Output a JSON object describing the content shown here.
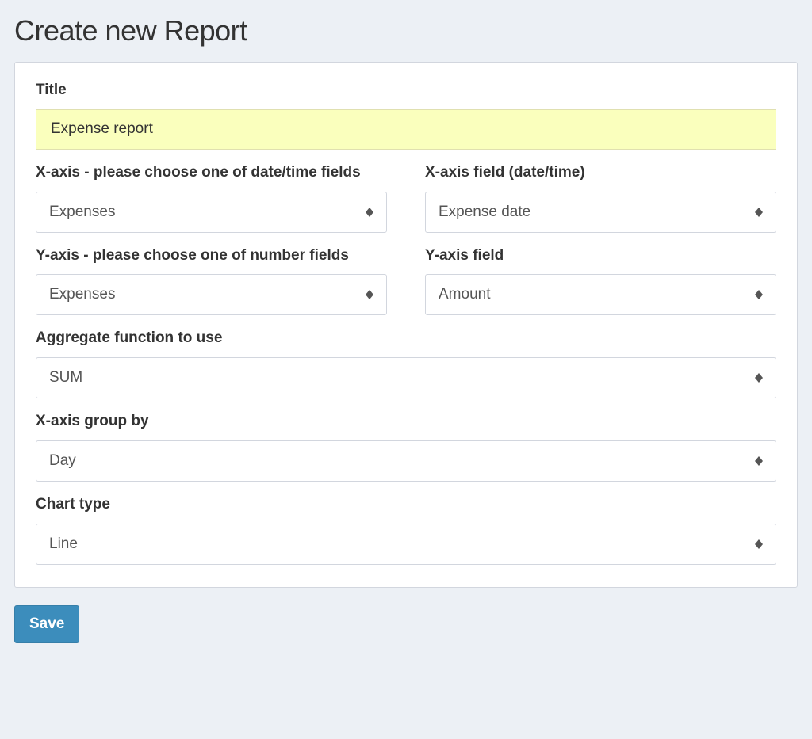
{
  "page": {
    "title": "Create new Report"
  },
  "form": {
    "title": {
      "label": "Title",
      "value": "Expense report"
    },
    "x_axis_crud": {
      "label": "X-axis - please choose one of date/time fields",
      "value": "Expenses"
    },
    "x_axis_field": {
      "label": "X-axis field (date/time)",
      "value": "Expense date"
    },
    "y_axis_crud": {
      "label": "Y-axis - please choose one of number fields",
      "value": "Expenses"
    },
    "y_axis_field": {
      "label": "Y-axis field",
      "value": "Amount"
    },
    "aggregate": {
      "label": "Aggregate function to use",
      "value": "SUM"
    },
    "group_by": {
      "label": "X-axis group by",
      "value": "Day"
    },
    "chart_type": {
      "label": "Chart type",
      "value": "Line"
    }
  },
  "buttons": {
    "save": "Save"
  }
}
